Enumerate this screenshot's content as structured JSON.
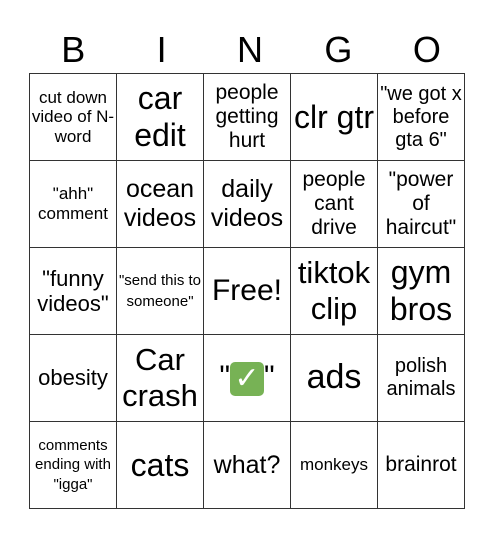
{
  "header": [
    "B",
    "I",
    "N",
    "G",
    "O"
  ],
  "rows": [
    [
      "cut down video of N-word",
      "car edit",
      "people getting hurt",
      "clr gtr",
      "\"we got x before gta 6\""
    ],
    [
      "\"ahh\" comment",
      "ocean videos",
      "daily videos",
      "people cant drive",
      "\"power of haircut\""
    ],
    [
      "\"funny videos\"",
      "\"send this to someone\"",
      "Free!",
      "tiktok clip",
      "gym bros"
    ],
    [
      "obesity",
      "Car crash",
      "\"✅\"",
      "ads",
      "polish animals"
    ],
    [
      "comments ending with \"igga\"",
      "cats",
      "what?",
      "monkeys",
      "brainrot"
    ]
  ],
  "checkmark_cell": {
    "quote_open": "\"",
    "icon": "check-mark-button-icon",
    "quote_close": "\"",
    "color": "#77b255"
  }
}
